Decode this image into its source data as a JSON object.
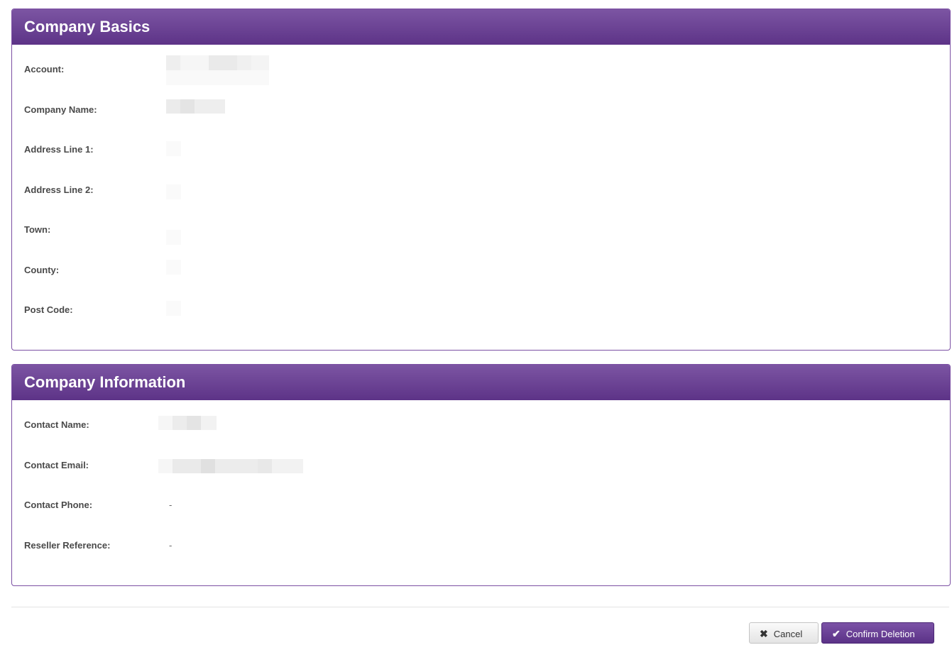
{
  "company_basics": {
    "title": "Company Basics",
    "fields": {
      "account": {
        "label": "Account:"
      },
      "company_name": {
        "label": "Company Name:"
      },
      "address_line_1": {
        "label": "Address Line 1:"
      },
      "address_line_2": {
        "label": "Address Line 2:"
      },
      "town": {
        "label": "Town:"
      },
      "county": {
        "label": "County:"
      },
      "post_code": {
        "label": "Post Code:"
      }
    }
  },
  "company_information": {
    "title": "Company Information",
    "fields": {
      "contact_name": {
        "label": "Contact Name:"
      },
      "contact_email": {
        "label": "Contact Email:"
      },
      "contact_phone": {
        "label": "Contact Phone:",
        "value": "-"
      },
      "reseller_reference": {
        "label": "Reseller Reference:",
        "value": "-"
      }
    }
  },
  "actions": {
    "cancel_label": "Cancel",
    "confirm_label": "Confirm Deletion",
    "cancel_icon": "x-icon",
    "confirm_icon": "check-icon"
  },
  "colors": {
    "accent": "#6a3f94",
    "panel_border": "#7b4fa3"
  }
}
